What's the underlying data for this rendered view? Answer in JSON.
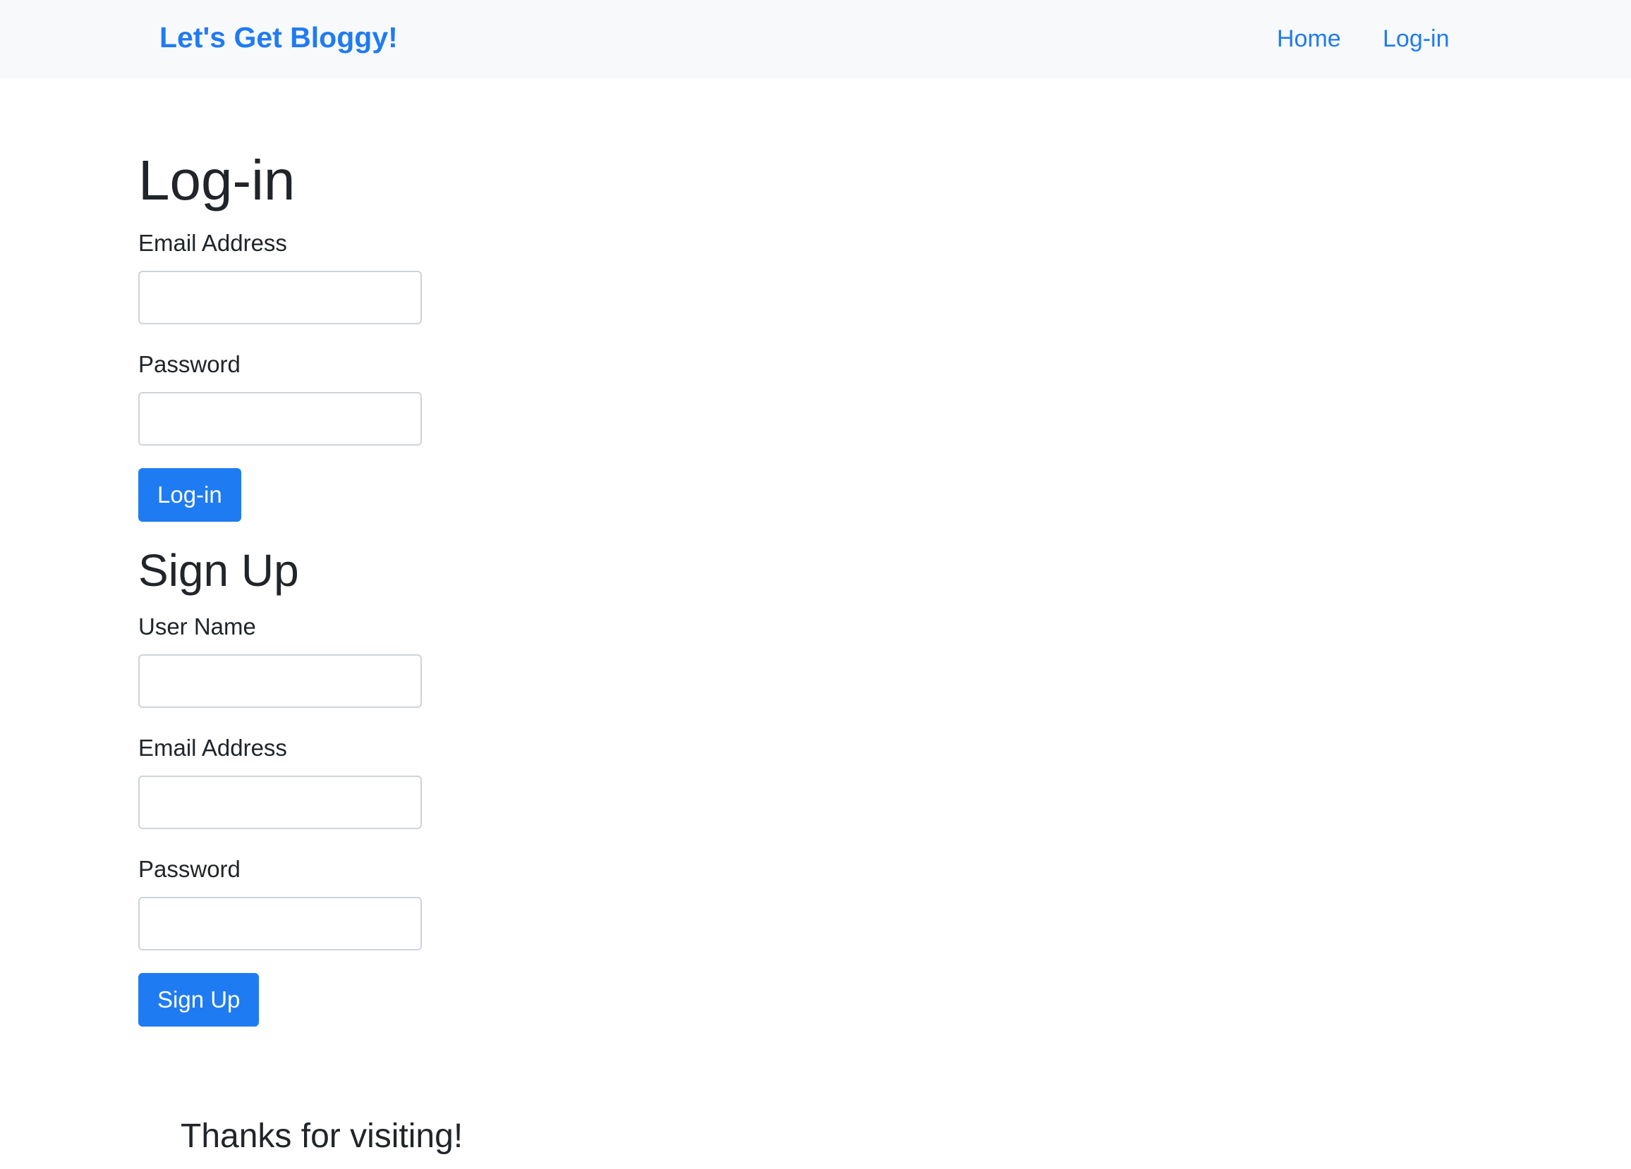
{
  "navbar": {
    "brand": "Let's Get Bloggy!",
    "links": [
      "Home",
      "Log-in"
    ]
  },
  "login": {
    "title": "Log-in",
    "email_label": "Email Address",
    "email_value": "",
    "password_label": "Password",
    "password_value": "",
    "button_label": "Log-in"
  },
  "signup": {
    "title": "Sign Up",
    "username_label": "User Name",
    "username_value": "",
    "email_label": "Email Address",
    "email_value": "",
    "password_label": "Password",
    "password_value": "",
    "button_label": "Sign Up"
  },
  "footer": {
    "text": "Thanks for visiting!"
  },
  "colors": {
    "accent": "#1f7bf2",
    "navbar_bg": "#f8f9fa",
    "text": "#212529",
    "input_border": "#ced4da"
  }
}
